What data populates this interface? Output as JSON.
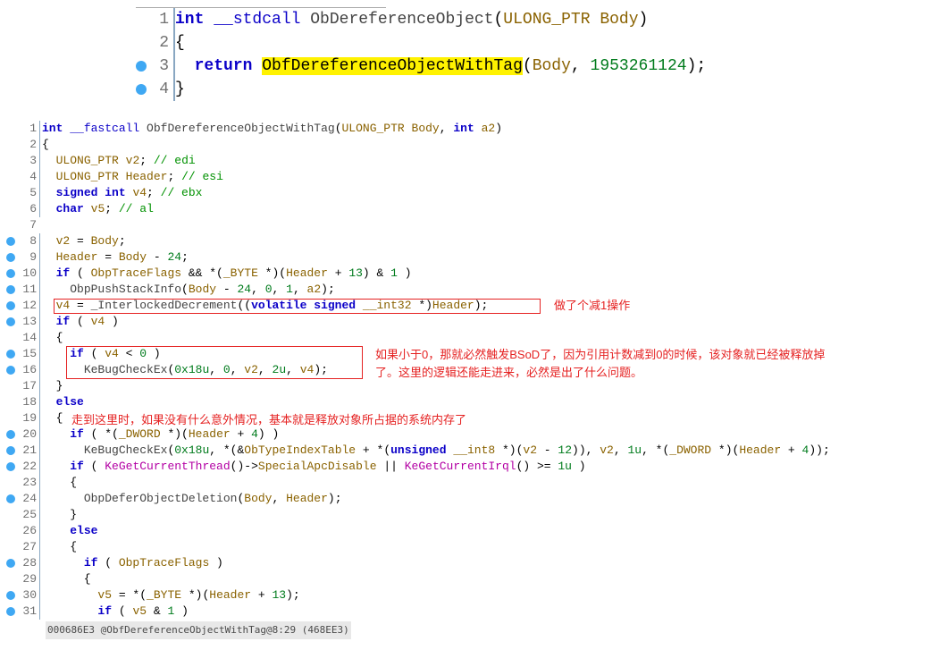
{
  "block1": {
    "lines": [
      {
        "n": 1,
        "bp": false,
        "tokens": [
          [
            "kw",
            "int"
          ],
          [
            "",
            " "
          ],
          [
            "kw-nb",
            "__stdcall"
          ],
          [
            "",
            " "
          ],
          [
            "fn",
            "ObDereferenceObject"
          ],
          [
            "",
            "("
          ],
          [
            "var",
            "ULONG_PTR"
          ],
          [
            "",
            " "
          ],
          [
            "var",
            "Body"
          ],
          [
            "",
            ")"
          ]
        ]
      },
      {
        "n": 2,
        "bp": false,
        "tokens": [
          [
            "",
            "{"
          ]
        ]
      },
      {
        "n": 3,
        "bp": true,
        "tokens": [
          [
            "",
            "  "
          ],
          [
            "kw",
            "return"
          ],
          [
            "",
            " "
          ],
          [
            "hl-yellow",
            "ObfDereferenceObjectWithTag"
          ],
          [
            "",
            "("
          ],
          [
            "var",
            "Body"
          ],
          [
            "",
            ", "
          ],
          [
            "num",
            "1953261124"
          ],
          [
            "",
            ");"
          ]
        ]
      },
      {
        "n": 4,
        "bp": true,
        "tokens": [
          [
            "",
            "}"
          ]
        ]
      }
    ]
  },
  "block2": {
    "lines": [
      {
        "n": 1,
        "bp": false,
        "tokens": [
          [
            "kw",
            "int"
          ],
          [
            "",
            " "
          ],
          [
            "kw-nb",
            "__fastcall"
          ],
          [
            "",
            " "
          ],
          [
            "fn",
            "ObfDereferenceObjectWithTag"
          ],
          [
            "",
            "("
          ],
          [
            "var",
            "ULONG_PTR"
          ],
          [
            "",
            " "
          ],
          [
            "var",
            "Body"
          ],
          [
            "",
            ", "
          ],
          [
            "kw",
            "int"
          ],
          [
            "",
            " "
          ],
          [
            "var",
            "a2"
          ],
          [
            "",
            ")"
          ]
        ]
      },
      {
        "n": 2,
        "bp": false,
        "tokens": [
          [
            "",
            "{"
          ]
        ]
      },
      {
        "n": 3,
        "bp": false,
        "tokens": [
          [
            "",
            "  "
          ],
          [
            "var",
            "ULONG_PTR"
          ],
          [
            "",
            " "
          ],
          [
            "var",
            "v2"
          ],
          [
            "",
            "; "
          ],
          [
            "comm",
            "// edi"
          ]
        ]
      },
      {
        "n": 4,
        "bp": false,
        "tokens": [
          [
            "",
            "  "
          ],
          [
            "var",
            "ULONG_PTR"
          ],
          [
            "",
            " "
          ],
          [
            "var",
            "Header"
          ],
          [
            "",
            "; "
          ],
          [
            "comm",
            "// esi"
          ]
        ]
      },
      {
        "n": 5,
        "bp": false,
        "tokens": [
          [
            "",
            "  "
          ],
          [
            "kw",
            "signed int"
          ],
          [
            "",
            " "
          ],
          [
            "var",
            "v4"
          ],
          [
            "",
            "; "
          ],
          [
            "comm",
            "// ebx"
          ]
        ]
      },
      {
        "n": 6,
        "bp": false,
        "tokens": [
          [
            "",
            "  "
          ],
          [
            "kw",
            "char"
          ],
          [
            "",
            " "
          ],
          [
            "var",
            "v5"
          ],
          [
            "",
            "; "
          ],
          [
            "comm",
            "// al"
          ]
        ]
      },
      {
        "n": 7,
        "bp": false,
        "tokens": [
          [
            "",
            ""
          ]
        ]
      },
      {
        "n": 8,
        "bp": true,
        "tokens": [
          [
            "",
            "  "
          ],
          [
            "var",
            "v2"
          ],
          [
            "",
            " = "
          ],
          [
            "var",
            "Body"
          ],
          [
            "",
            ";"
          ]
        ]
      },
      {
        "n": 9,
        "bp": true,
        "tokens": [
          [
            "",
            "  "
          ],
          [
            "var",
            "Header"
          ],
          [
            "",
            " = "
          ],
          [
            "var",
            "Body"
          ],
          [
            "",
            " - "
          ],
          [
            "num",
            "24"
          ],
          [
            "",
            ";"
          ]
        ]
      },
      {
        "n": 10,
        "bp": true,
        "tokens": [
          [
            "",
            "  "
          ],
          [
            "kw",
            "if"
          ],
          [
            "",
            " ( "
          ],
          [
            "var",
            "ObpTraceFlags"
          ],
          [
            "",
            " && *("
          ],
          [
            "var",
            "_BYTE"
          ],
          [
            "",
            " *)("
          ],
          [
            "var",
            "Header"
          ],
          [
            "",
            " + "
          ],
          [
            "num",
            "13"
          ],
          [
            "",
            ") & "
          ],
          [
            "num",
            "1"
          ],
          [
            "",
            " )"
          ]
        ]
      },
      {
        "n": 11,
        "bp": true,
        "tokens": [
          [
            "",
            "    "
          ],
          [
            "fn",
            "ObpPushStackInfo"
          ],
          [
            "",
            "("
          ],
          [
            "var",
            "Body"
          ],
          [
            "",
            " - "
          ],
          [
            "num",
            "24"
          ],
          [
            "",
            ", "
          ],
          [
            "num",
            "0"
          ],
          [
            "",
            ", "
          ],
          [
            "num",
            "1"
          ],
          [
            "",
            ", "
          ],
          [
            "var",
            "a2"
          ],
          [
            "",
            ");"
          ]
        ]
      },
      {
        "n": 12,
        "bp": true,
        "tokens": [
          [
            "",
            "  "
          ],
          [
            "var",
            "v4"
          ],
          [
            "",
            " = "
          ],
          [
            "fn",
            "_InterlockedDecrement"
          ],
          [
            "",
            "(("
          ],
          [
            "kw",
            "volatile signed"
          ],
          [
            "",
            " "
          ],
          [
            "var",
            "__int32"
          ],
          [
            "",
            " *)"
          ],
          [
            "var",
            "Header"
          ],
          [
            "",
            ");"
          ]
        ]
      },
      {
        "n": 13,
        "bp": true,
        "tokens": [
          [
            "",
            "  "
          ],
          [
            "kw",
            "if"
          ],
          [
            "",
            " ( "
          ],
          [
            "var",
            "v4"
          ],
          [
            "",
            " )"
          ]
        ]
      },
      {
        "n": 14,
        "bp": false,
        "tokens": [
          [
            "",
            "  {"
          ]
        ]
      },
      {
        "n": 15,
        "bp": true,
        "tokens": [
          [
            "",
            "    "
          ],
          [
            "kw",
            "if"
          ],
          [
            "",
            " ( "
          ],
          [
            "var",
            "v4"
          ],
          [
            "",
            " < "
          ],
          [
            "num",
            "0"
          ],
          [
            "",
            " )"
          ]
        ]
      },
      {
        "n": 16,
        "bp": true,
        "tokens": [
          [
            "",
            "      "
          ],
          [
            "fn",
            "KeBugCheckEx"
          ],
          [
            "",
            "("
          ],
          [
            "num",
            "0x18u"
          ],
          [
            "",
            ", "
          ],
          [
            "num",
            "0"
          ],
          [
            "",
            ", "
          ],
          [
            "var",
            "v2"
          ],
          [
            "",
            ", "
          ],
          [
            "num",
            "2u"
          ],
          [
            "",
            ", "
          ],
          [
            "var",
            "v4"
          ],
          [
            "",
            ");"
          ]
        ]
      },
      {
        "n": 17,
        "bp": false,
        "tokens": [
          [
            "",
            "  }"
          ]
        ]
      },
      {
        "n": 18,
        "bp": false,
        "tokens": [
          [
            "",
            "  "
          ],
          [
            "kw",
            "else"
          ]
        ]
      },
      {
        "n": 19,
        "bp": false,
        "tokens": [
          [
            "",
            "  {"
          ]
        ]
      },
      {
        "n": 20,
        "bp": true,
        "tokens": [
          [
            "",
            "    "
          ],
          [
            "kw",
            "if"
          ],
          [
            "",
            " ( *("
          ],
          [
            "var",
            "_DWORD"
          ],
          [
            "",
            " *)("
          ],
          [
            "var",
            "Header"
          ],
          [
            "",
            " + "
          ],
          [
            "num",
            "4"
          ],
          [
            "",
            ") )"
          ]
        ]
      },
      {
        "n": 21,
        "bp": true,
        "tokens": [
          [
            "",
            "      "
          ],
          [
            "fn",
            "KeBugCheckEx"
          ],
          [
            "",
            "("
          ],
          [
            "num",
            "0x18u"
          ],
          [
            "",
            ", *(&"
          ],
          [
            "var",
            "ObTypeIndexTable"
          ],
          [
            "",
            " + *("
          ],
          [
            "kw",
            "unsigned"
          ],
          [
            "",
            " "
          ],
          [
            "var",
            "__int8"
          ],
          [
            "",
            " *)("
          ],
          [
            "var",
            "v2"
          ],
          [
            "",
            " - "
          ],
          [
            "num",
            "12"
          ],
          [
            "",
            ")), "
          ],
          [
            "var",
            "v2"
          ],
          [
            "",
            ", "
          ],
          [
            "num",
            "1u"
          ],
          [
            "",
            ", *("
          ],
          [
            "var",
            "_DWORD"
          ],
          [
            "",
            " *)("
          ],
          [
            "var",
            "Header"
          ],
          [
            "",
            " + "
          ],
          [
            "num",
            "4"
          ],
          [
            "",
            "));"
          ]
        ]
      },
      {
        "n": 22,
        "bp": true,
        "tokens": [
          [
            "",
            "    "
          ],
          [
            "kw",
            "if"
          ],
          [
            "",
            " ( "
          ],
          [
            "purple-fn",
            "KeGetCurrentThread"
          ],
          [
            "",
            "()->"
          ],
          [
            "var",
            "SpecialApcDisable"
          ],
          [
            "",
            " || "
          ],
          [
            "purple-fn",
            "KeGetCurrentIrql"
          ],
          [
            "",
            "() >= "
          ],
          [
            "num",
            "1u"
          ],
          [
            "",
            " )"
          ]
        ]
      },
      {
        "n": 23,
        "bp": false,
        "tokens": [
          [
            "",
            "    {"
          ]
        ]
      },
      {
        "n": 24,
        "bp": true,
        "tokens": [
          [
            "",
            "      "
          ],
          [
            "fn",
            "ObpDeferObjectDeletion"
          ],
          [
            "",
            "("
          ],
          [
            "var",
            "Body"
          ],
          [
            "",
            ", "
          ],
          [
            "var",
            "Header"
          ],
          [
            "",
            ");"
          ]
        ]
      },
      {
        "n": 25,
        "bp": false,
        "tokens": [
          [
            "",
            "    }"
          ]
        ]
      },
      {
        "n": 26,
        "bp": false,
        "tokens": [
          [
            "",
            "    "
          ],
          [
            "kw",
            "else"
          ]
        ]
      },
      {
        "n": 27,
        "bp": false,
        "tokens": [
          [
            "",
            "    {"
          ]
        ]
      },
      {
        "n": 28,
        "bp": true,
        "tokens": [
          [
            "",
            "      "
          ],
          [
            "kw",
            "if"
          ],
          [
            "",
            " ( "
          ],
          [
            "var",
            "ObpTraceFlags"
          ],
          [
            "",
            " )"
          ]
        ]
      },
      {
        "n": 29,
        "bp": false,
        "tokens": [
          [
            "",
            "      {"
          ]
        ]
      },
      {
        "n": 30,
        "bp": true,
        "tokens": [
          [
            "",
            "        "
          ],
          [
            "var",
            "v5"
          ],
          [
            "",
            " = *("
          ],
          [
            "var",
            "_BYTE"
          ],
          [
            "",
            " *)("
          ],
          [
            "var",
            "Header"
          ],
          [
            "",
            " + "
          ],
          [
            "num",
            "13"
          ],
          [
            "",
            ");"
          ]
        ]
      },
      {
        "n": 31,
        "bp": true,
        "tokens": [
          [
            "",
            "        "
          ],
          [
            "kw",
            "if"
          ],
          [
            "",
            " ( "
          ],
          [
            "var",
            "v5"
          ],
          [
            "",
            " & "
          ],
          [
            "num",
            "1"
          ],
          [
            "",
            " )"
          ]
        ]
      }
    ],
    "statusbar": "000686E3 @ObfDereferenceObjectWithTag@8:29 (468EE3)"
  },
  "annotations": {
    "a1": "做了个减1操作",
    "a2_line1": "如果小于0，那就必然触发BSoD了，因为引用计数减到0的时候，该对象就已经被释放掉",
    "a2_line2": "了。这里的逻辑还能走进来，必然是出了什么问题。",
    "a3": "走到这里时，如果没有什么意外情况，基本就是释放对象所占据的系统内存了"
  }
}
